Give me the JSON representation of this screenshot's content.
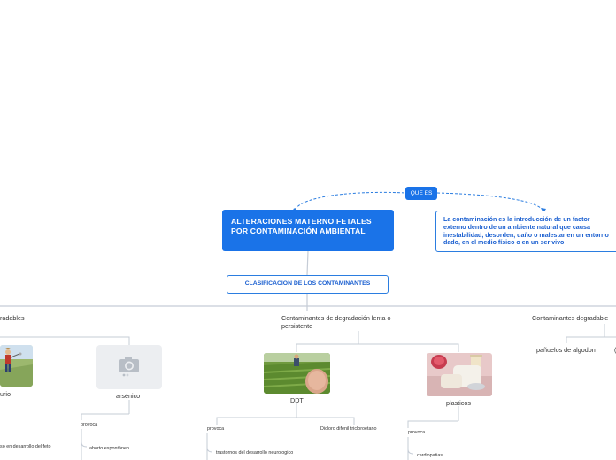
{
  "root": {
    "title": "ALTERACIONES MATERNO FETALES POR CONTAMINACIÓN AMBIENTAL"
  },
  "que_es": {
    "label": "QUE ES"
  },
  "definition": {
    "text": "La contaminación es la introducción de un factor externo dentro de un ambiente natural que causa inestabilidad, desorden, daño o malestar en un entorno dado, en el medio físico o en un ser vivo"
  },
  "clasificacion": {
    "label": "CLASIFICACIÓN DE LOS CONTAMINANTES"
  },
  "categories": {
    "left": "radables",
    "middle": "Contaminantes de degradación lenta o persistente",
    "right": "Contaminantes degradable"
  },
  "left_branch": {
    "image_caption": "urio",
    "arsenico": "arsénico",
    "provoca": "provoca",
    "aborto": "aborto espontáneo",
    "retraso": "so en desarrollo del feto"
  },
  "middle_branch": {
    "ddt": "DDT",
    "plasticos": "plasticos",
    "ddt_provoca": "provoca",
    "ddt_full": "Dicloro difenil tricloroetano",
    "trastornos": "trastornos del desarrollo neurologico",
    "plasticos_provoca": "provoca",
    "cardiopatias": "cardiopatias"
  },
  "right_branch": {
    "panuelos": "pañuelos de algodon"
  },
  "colors": {
    "accent": "#1a73e8",
    "line": "#c5ccd6",
    "dashed": "#2b7de0"
  }
}
